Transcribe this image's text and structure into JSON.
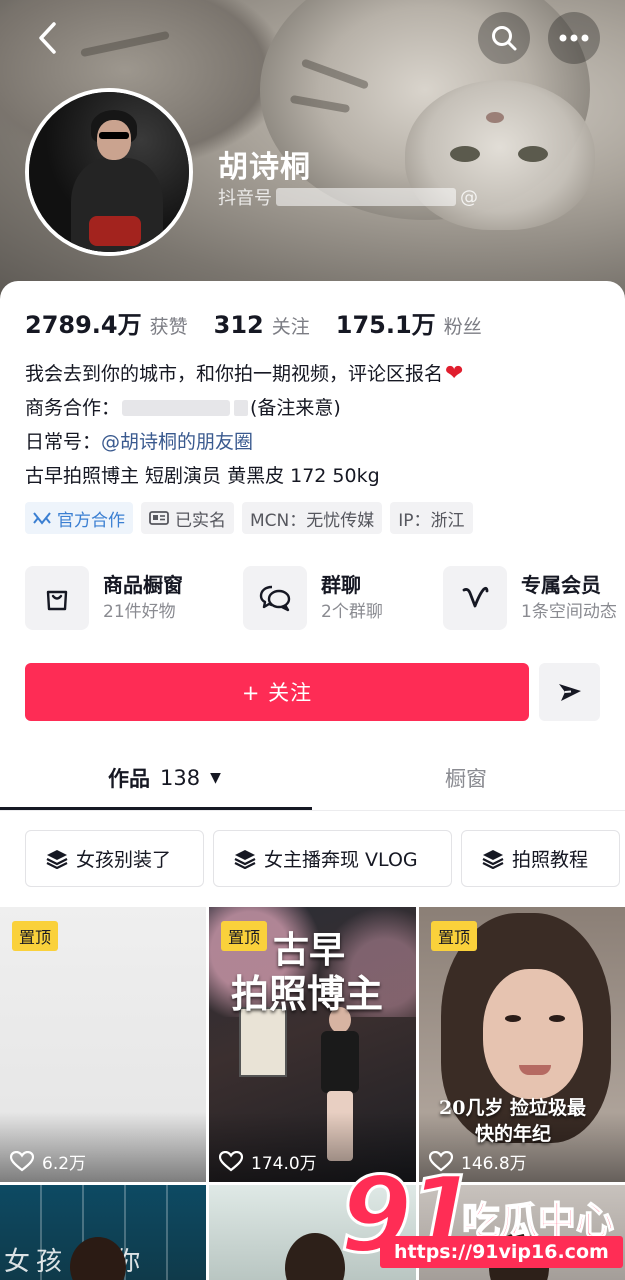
{
  "profile": {
    "name": "胡诗桐",
    "id_label": "抖音号",
    "id_suffix": "@"
  },
  "stats": [
    {
      "value": "2789.4万",
      "label": "获赞"
    },
    {
      "value": "312",
      "label": "关注"
    },
    {
      "value": "175.1万",
      "label": "粉丝"
    }
  ],
  "bio": {
    "line1": "我会去到你的城市，和你拍一期视频，评论区报名",
    "line2_prefix": "商务合作：",
    "line2_suffix": "(备注来意)",
    "line3_prefix": "日常号：",
    "line3_link": "@胡诗桐的朋友圈",
    "line4": "古早拍照博主 短剧演员 黄黑皮 172 50kg"
  },
  "tags": [
    "官方合作",
    "已实名",
    "MCN：无忧传媒",
    "IP：浙江"
  ],
  "services": [
    {
      "title": "商品橱窗",
      "sub": "21件好物",
      "icon": "shopping-bag-icon"
    },
    {
      "title": "群聊",
      "sub": "2个群聊",
      "icon": "chat-bubbles-icon"
    },
    {
      "title": "专属会员",
      "sub": "1条空间动态",
      "icon": "vip-v-icon"
    }
  ],
  "actions": {
    "follow": "+ 关注"
  },
  "tabs": {
    "works_label": "作品",
    "works_count": "138",
    "window_label": "橱窗"
  },
  "collections": [
    "女孩别装了",
    "女主播奔现 VLOG",
    "拍照教程"
  ],
  "videos": [
    {
      "pinned": "置顶",
      "likes": "6.2万"
    },
    {
      "pinned": "置顶",
      "likes": "174.0万",
      "overlay_line1": "古早",
      "overlay_line2": "拍照博主"
    },
    {
      "pinned": "置顶",
      "likes": "146.8万",
      "overlay_line1": "20几岁 捡垃圾最",
      "overlay_line2": "快的年纪"
    }
  ],
  "bottom_row_text": "女孩   教你",
  "watermark": {
    "brand": "91",
    "name": "吃瓜中心",
    "url": "https://91vip16.com"
  },
  "colors": {
    "accent": "#fe2c55",
    "pin": "#fad13b",
    "link": "#3a5a8f",
    "official": "#3b7fd2"
  }
}
